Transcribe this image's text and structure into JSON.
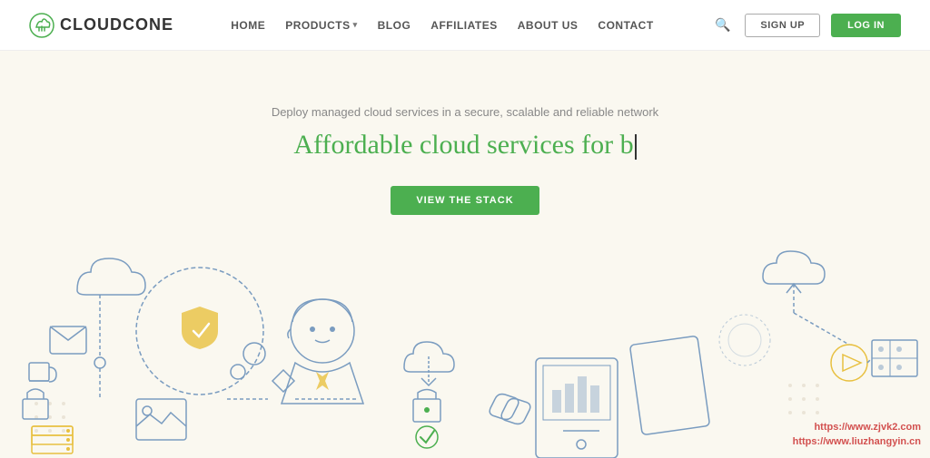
{
  "header": {
    "logo_text": "CLOUDCONE",
    "nav_items": [
      {
        "label": "HOME",
        "has_dropdown": false
      },
      {
        "label": "PRODUCTS",
        "has_dropdown": true
      },
      {
        "label": "BLOG",
        "has_dropdown": false
      },
      {
        "label": "AFFILIATES",
        "has_dropdown": false
      },
      {
        "label": "ABOUT US",
        "has_dropdown": false
      },
      {
        "label": "CONTACT",
        "has_dropdown": false
      }
    ],
    "btn_signup": "SIGN UP",
    "btn_login": "LOG IN"
  },
  "hero": {
    "subtitle": "Deploy managed cloud services in a secure, scalable and reliable network",
    "title_prefix": "Affordable cloud services for b",
    "cta_button": "VIEW THE STACK"
  },
  "watermark": {
    "line1": "https://www.zjvk2.com",
    "line2": "https://www.liuzhangyin.cn"
  }
}
